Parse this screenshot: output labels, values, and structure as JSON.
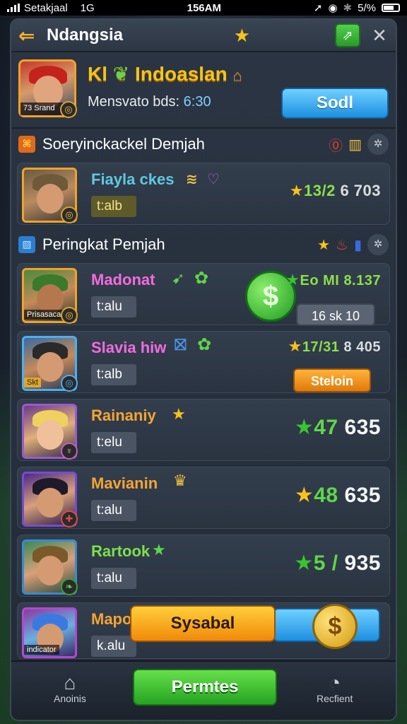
{
  "status_bar": {
    "carrier": "Setakjaal",
    "network": "1G",
    "time": "156AM",
    "battery": "5/%"
  },
  "header": {
    "title": "Ndangsia"
  },
  "profile": {
    "avatar_label": "73 Srand",
    "name_part1": "Kl",
    "name_part2": "Indoaslan",
    "subtitle_label": "Mensvato bds:",
    "subtitle_value": "6:30",
    "button_label": "Sodl"
  },
  "section1": {
    "title": "Soeryinckackel Demjah",
    "row": {
      "name": "Fiayla ckes",
      "tag": "t:alb",
      "score_green": "13/2",
      "score_white": "6 703"
    }
  },
  "section2": {
    "title": "Peringkat Pemjah"
  },
  "leaderboard": [
    {
      "name": "Madonat",
      "name_color": "#f36be0",
      "tag": "t:alu",
      "avatar_label": "Prisasaca",
      "score_green": "Eo MI",
      "score_white": "8.137",
      "button": "16 sk 10"
    },
    {
      "name": "Slavia hiw",
      "name_color": "#f36be0",
      "tag": "t:alb",
      "avatar_label": "Skt",
      "score_green": "17/31",
      "score_white": "8 405",
      "button": "Steloin"
    },
    {
      "name": "Rainaniy",
      "name_color": "#f5a531",
      "tag": "t:elu",
      "score_green": "47",
      "score_white": "635"
    },
    {
      "name": "Mavianin",
      "name_color": "#f5a531",
      "tag": "t:alu",
      "score_green": "48",
      "score_white": "635"
    },
    {
      "name": "Rartook",
      "name_color": "#7de04a",
      "tag": "t:alu",
      "score_green": "5 /",
      "score_white": "935"
    },
    {
      "name": "Maponti",
      "name_color": "#f5a531",
      "tag": "k.alu",
      "avatar_label": "indicator"
    }
  ],
  "bottom": {
    "primary_button": "Sysabal",
    "main_button": "Permtes",
    "tab_left": "Anoinis",
    "tab_right": "Recfient"
  },
  "colors": {
    "accent_gold": "#f7c21b",
    "accent_green": "#5fd64a",
    "accent_blue": "#1d8fe0",
    "accent_orange": "#f08a0a"
  }
}
